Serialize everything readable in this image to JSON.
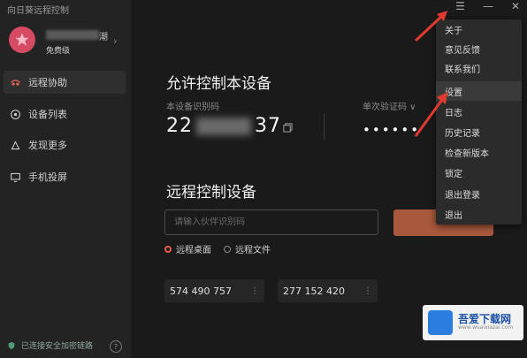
{
  "window": {
    "title": "向日葵远程控制",
    "controls": [
      "☰",
      "—",
      "✕"
    ]
  },
  "profile": {
    "name_tail": "潮",
    "badge": "免费级"
  },
  "sidebar": {
    "items": [
      {
        "label": "远程协助",
        "icon": "remote-assist-icon",
        "active": true
      },
      {
        "label": "设备列表",
        "icon": "device-list-icon"
      },
      {
        "label": "发现更多",
        "icon": "discover-icon"
      },
      {
        "label": "手机投屏",
        "icon": "phone-cast-icon"
      }
    ],
    "status": "已连接安全加密链路",
    "help": "?"
  },
  "allow": {
    "title": "允许控制本设备",
    "code_label": "本设备识别码",
    "code_prefix": "22",
    "code_suffix": "37",
    "pwd_label": "单次验证码 ∨",
    "pwd_value": "••••••"
  },
  "remote": {
    "title": "远程控制设备",
    "input_placeholder": "请输入伙伴识别码",
    "radios": [
      {
        "label": "远程桌面",
        "checked": true
      },
      {
        "label": "远程文件",
        "checked": false
      }
    ],
    "history": [
      "574 490 757",
      "277 152 420"
    ]
  },
  "menu": {
    "items": [
      "关于",
      "意见反馈",
      "联系我们",
      "设置",
      "日志",
      "历史记录",
      "检查新版本",
      "锁定",
      "退出登录",
      "退出"
    ],
    "highlighted_index": 3
  },
  "colors": {
    "accent": "#e06050",
    "connect_button": "#a8583d",
    "annotation_arrow": "#e03a2e"
  },
  "watermark": {
    "name": "吾爱下载网",
    "url": "www.wuaixiazai.com"
  }
}
